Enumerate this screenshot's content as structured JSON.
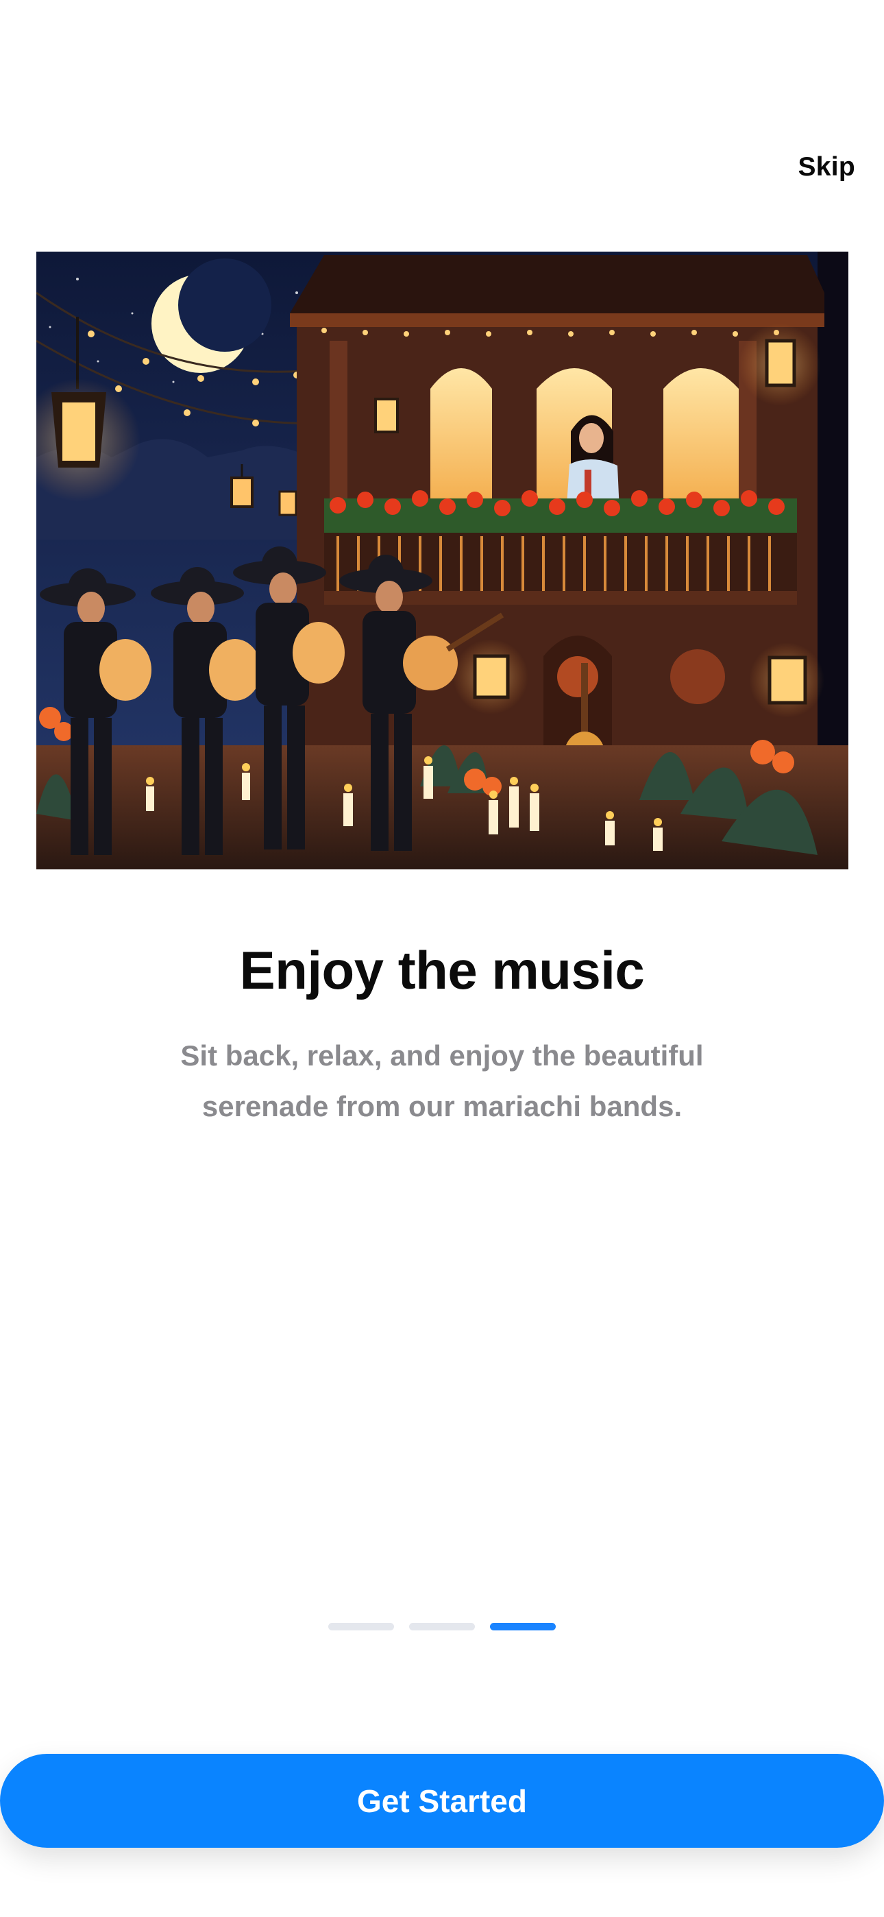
{
  "top_bar": {
    "skip_label": "Skip"
  },
  "hero": {
    "image_subject": "mariachi band serenading a woman on a lit balcony at night"
  },
  "content": {
    "title": "Enjoy the music",
    "description": "Sit back, relax, and enjoy the beautiful serenade from our mariachi bands."
  },
  "pager": {
    "total": 3,
    "current": 3
  },
  "cta": {
    "label": "Get Started"
  },
  "colors": {
    "accent": "#0a84ff",
    "title": "#0b0b0b",
    "description": "#8a8a8e",
    "dot_inactive": "#e4e7ed"
  }
}
